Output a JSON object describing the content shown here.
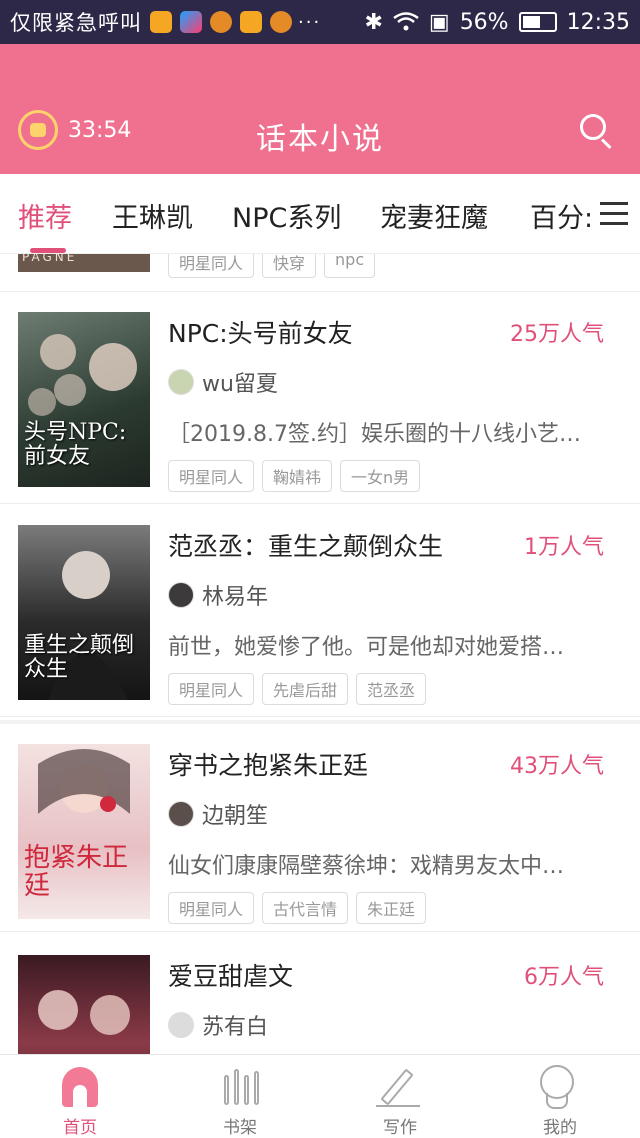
{
  "status_bar": {
    "carrier": "仅限紧急呼叫",
    "more": "···",
    "battery": "56%",
    "battery_level": 0.56,
    "time": "12:35"
  },
  "header": {
    "timer": "33:54",
    "title": "话本小说"
  },
  "tabs": [
    {
      "label": "推荐",
      "active": true
    },
    {
      "label": "王琳凯",
      "active": false
    },
    {
      "label": "NPC系列",
      "active": false
    },
    {
      "label": "宠妻狂魔",
      "active": false
    },
    {
      "label": "百分:",
      "active": false
    }
  ],
  "partial_item": {
    "cover_text": "PAGNE",
    "tags": [
      "明星同人",
      "快穿",
      "npc"
    ]
  },
  "books": [
    {
      "title": "NPC:头号前女友",
      "popularity": "25万人气",
      "author": "wu留夏",
      "summary": "［2019.8.7签.约］娱乐圈的十八线小艺…",
      "tags": [
        "明星同人",
        "鞠婧祎",
        "一女n男"
      ],
      "cover_text": "头号NPC:前女友",
      "cover_color": "#3b4a3e"
    },
    {
      "title": "范丞丞：重生之颠倒众生",
      "popularity": "1万人气",
      "author": "林易年",
      "summary": "前世，她爱惨了他。可是他却对她爱搭…",
      "tags": [
        "明星同人",
        "先虐后甜",
        "范丞丞"
      ],
      "cover_text": "重生之颠倒众生",
      "cover_color": "#2a2a2a"
    },
    {
      "title": "穿书之抱紧朱正廷",
      "popularity": "43万人气",
      "author": "边朝笙",
      "summary": "仙女们康康隔壁蔡徐坤：戏精男友太中…",
      "tags": [
        "明星同人",
        "古代言情",
        "朱正廷"
      ],
      "cover_text": "抱紧朱正廷",
      "cover_color": "#e8cdd0"
    },
    {
      "title": "爱豆甜虐文",
      "popularity": "6万人气",
      "author": "苏有白",
      "summary": "",
      "tags": [],
      "cover_text": "",
      "cover_color": "#7a3440"
    }
  ],
  "bottom_nav": [
    {
      "label": "首页",
      "icon": "home-icon",
      "active": true
    },
    {
      "label": "书架",
      "icon": "bookshelf-icon",
      "active": false
    },
    {
      "label": "写作",
      "icon": "pen-icon",
      "active": false
    },
    {
      "label": "我的",
      "icon": "profile-icon",
      "active": false
    }
  ],
  "colors": {
    "accent": "#e05079",
    "header_bg": "#f07090",
    "status_bg": "#2d2748"
  }
}
